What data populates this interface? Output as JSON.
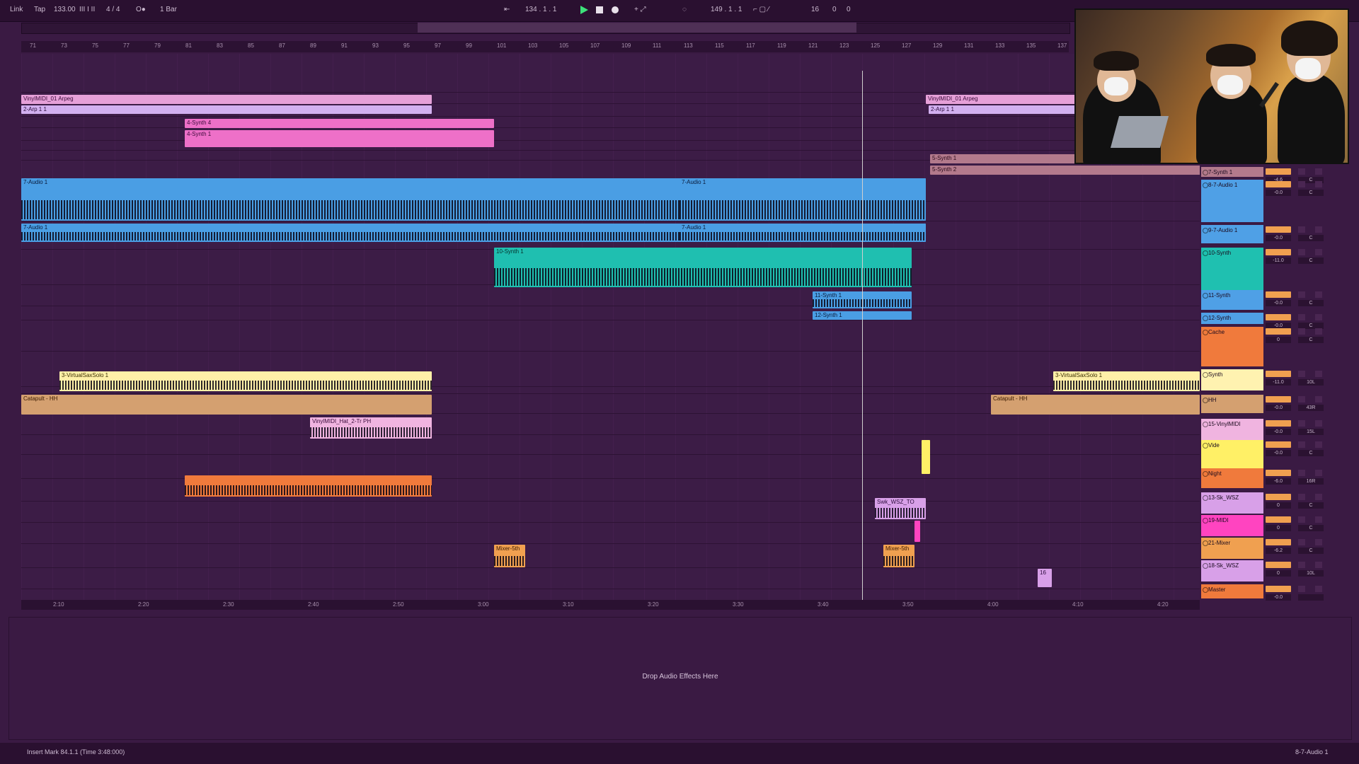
{
  "transport": {
    "left_items": [
      "Link",
      "Tap",
      "133.00",
      "III I II",
      "4 / 4",
      "O●",
      "1 Bar"
    ],
    "position": "134 . 1 . 1",
    "loop_end": "149 . 1 . 1",
    "right_values": [
      "16",
      "0",
      "0"
    ]
  },
  "ruler_ticks": [
    "71",
    "73",
    "75",
    "77",
    "79",
    "81",
    "83",
    "85",
    "87",
    "89",
    "91",
    "93",
    "95",
    "97",
    "99",
    "101",
    "103",
    "105",
    "107",
    "109",
    "111",
    "113",
    "115",
    "117",
    "119",
    "121",
    "123",
    "125",
    "127",
    "129",
    "131",
    "133",
    "135",
    "137"
  ],
  "time_ticks": [
    "2:10",
    "2:20",
    "2:30",
    "2:40",
    "2:50",
    "3:00",
    "3:10",
    "3:20",
    "3:30",
    "3:40",
    "3:50",
    "4:00",
    "4:10",
    "4:20"
  ],
  "clips": {
    "pink_top": "VinylMIDI_01 Arpeg",
    "pink_top_right": "VinylMIDI_01 Arpeg",
    "lav_a": "2-Arp 1 1",
    "lav_b": "2-Arp 1 1",
    "hot_a": "4-Synth 4",
    "hot_b": "4-Synth 1",
    "mauve_a": "5-Synth 1",
    "mauve_b": "5-Synth 2",
    "audio_a": "7-Audio 1",
    "audio_b": "7-Audio 1",
    "audio_c": "7-Audio 1",
    "audio_d": "7-Audio 1",
    "teal": "10-Synth 1",
    "blue_a": "11-Synth 1",
    "blue_b": "12-Synth 1",
    "yellow_a": "3-VirtualSaxSolo 1",
    "yellow_b": "3-VirtualSaxSolo 1",
    "tan_a": "Catapult - HH",
    "tan_b": "Catapult - HH",
    "pink_small": "VinylMIDI_Hat_2-Tr PH",
    "small_lav": "Swk_WSZ_TO",
    "orange_a": "Mixer-5th",
    "orange_b": "Mixer-5th",
    "tiny_lav": "16"
  },
  "tracks": [
    {
      "name": "7-Synth 1",
      "color": "#b37a8c"
    },
    {
      "name": "8-7-Audio 1",
      "color": "#4fa0e6"
    },
    {
      "name": "9-7-Audio 1",
      "color": "#4fa0e6"
    },
    {
      "name": "10-Synth",
      "color": "#1fc0b0"
    },
    {
      "name": "11-Synth",
      "color": "#4fa0e6"
    },
    {
      "name": "12-Synth",
      "color": "#4fa0e6"
    },
    {
      "name": "Cache",
      "color": "#f07a3c"
    },
    {
      "name": "Synth",
      "color": "#fff2b0"
    },
    {
      "name": "HH",
      "color": "#d4a070"
    },
    {
      "name": "15-VinylMIDI",
      "color": "#f0b4e0"
    },
    {
      "name": "Vide",
      "color": "#fff066"
    },
    {
      "name": "Night",
      "color": "#f07a3c"
    },
    {
      "name": "13-Sk_WSZ",
      "color": "#d8a0e8"
    },
    {
      "name": "19-MIDI",
      "color": "#ff44c0"
    },
    {
      "name": "21-Mixer",
      "color": "#f0a050"
    },
    {
      "name": "18-Sk_WSZ",
      "color": "#d8a0e8"
    },
    {
      "name": "Master",
      "color": "#f07a3c"
    }
  ],
  "mix_values": [
    {
      "vol": "-4.6",
      "pan": "C"
    },
    {
      "vol": "-0.0",
      "pan": "C"
    },
    {
      "vol": "-0.0",
      "pan": "C"
    },
    {
      "vol": "-11.0",
      "pan": "C"
    },
    {
      "vol": "-0.0",
      "pan": "C"
    },
    {
      "vol": "-0.0",
      "pan": "C"
    },
    {
      "vol": "0",
      "pan": "C"
    },
    {
      "vol": "-11.0",
      "pan": "10L"
    },
    {
      "vol": "-0.0",
      "pan": "43R"
    },
    {
      "vol": "-0.0",
      "pan": "15L"
    },
    {
      "vol": "-0.0",
      "pan": "C"
    },
    {
      "vol": "-6.0",
      "pan": "16R"
    },
    {
      "vol": "0",
      "pan": "C"
    },
    {
      "vol": "0",
      "pan": "C"
    },
    {
      "vol": "-6.2",
      "pan": "C"
    },
    {
      "vol": "0",
      "pan": "10L"
    },
    {
      "vol": "-0.0",
      "pan": ""
    }
  ],
  "device_hint": "Drop Audio Effects Here",
  "status_text": "Insert Mark 84.1.1 (Time 3:48:000)",
  "status_track": "8-7-Audio 1"
}
